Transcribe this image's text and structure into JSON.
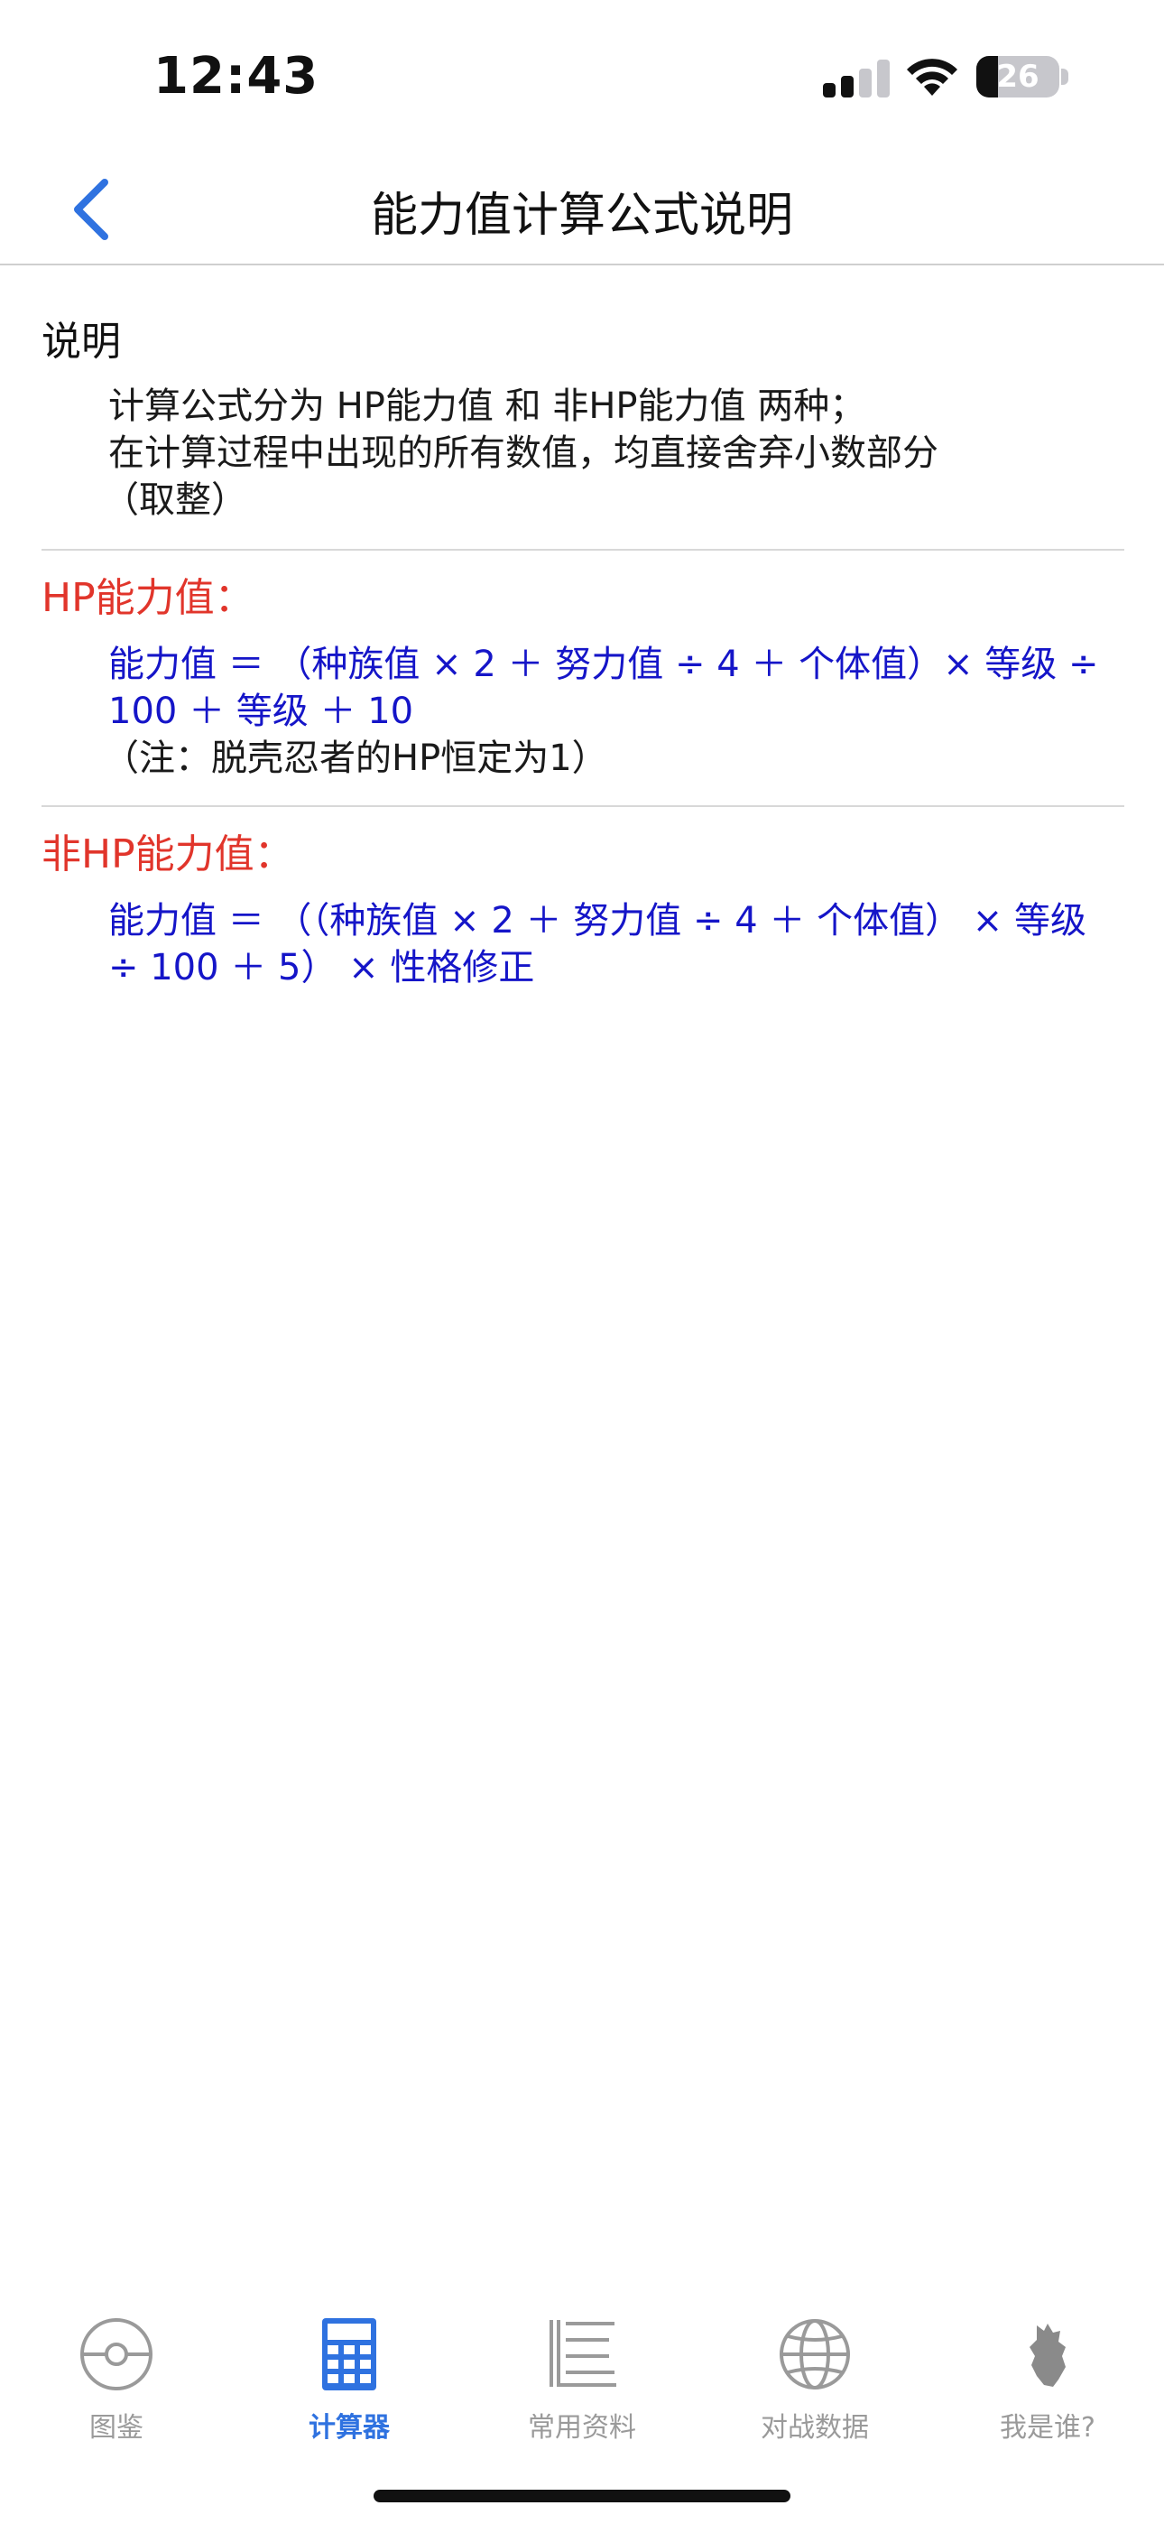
{
  "status_bar": {
    "time": "12:43",
    "battery": "26"
  },
  "nav": {
    "title": "能力值计算公式说明",
    "back_icon": "chevron-left-icon"
  },
  "sections": {
    "intro": {
      "title": "说明",
      "lines": [
        "计算公式分为 HP能力值 和 非HP能力值 两种；",
        "在计算过程中出现的所有数值，均直接舍弃小数部分",
        "（取整）"
      ]
    },
    "hp": {
      "title": "HP能力值：",
      "formula": [
        "能力值 ＝ （种族值 × 2 ＋ 努力值 ÷ 4 ＋ 个体值）× 等级 ÷",
        "100 ＋ 等级 ＋ 10"
      ],
      "note": "（注：脱壳忍者的HP恒定为1）"
    },
    "nonhp": {
      "title": "非HP能力值：",
      "formula": [
        "能力值 ＝ （（种族值 × 2 ＋ 努力值 ÷ 4 ＋ 个体值） × 等级",
        "÷ 100 ＋ 5） × 性格修正"
      ]
    }
  },
  "tabbar": {
    "items": [
      {
        "label": "图鉴",
        "icon": "pokeball-icon"
      },
      {
        "label": "计算器",
        "icon": "calculator-icon",
        "active": true
      },
      {
        "label": "常用资料",
        "icon": "book-icon"
      },
      {
        "label": "对战数据",
        "icon": "globe-icon"
      },
      {
        "label": "我是谁?",
        "icon": "silhouette-icon"
      }
    ]
  },
  "colors": {
    "accent_blue": "#2f72e0",
    "formula_blue": "#1515c8",
    "heading_red": "#e1352b"
  }
}
